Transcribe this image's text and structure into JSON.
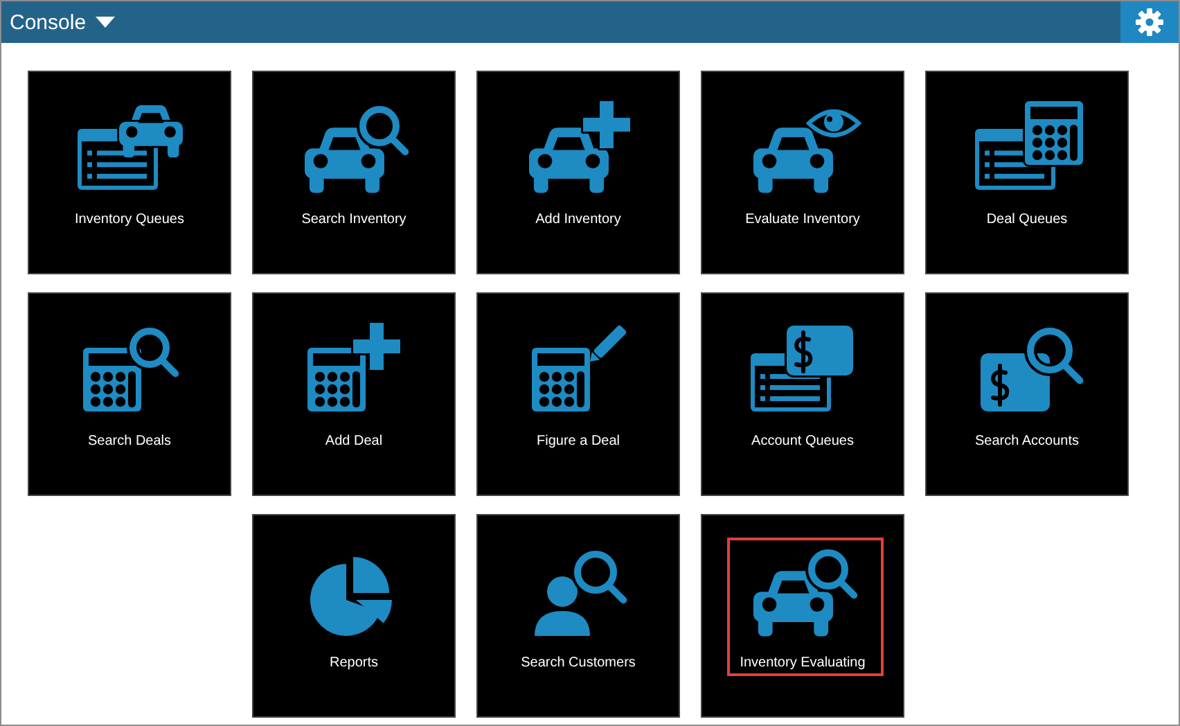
{
  "header": {
    "title": "Console"
  },
  "rows": [
    [
      {
        "label": "Inventory Queues",
        "kind": "list-car",
        "highlighted": false
      },
      {
        "label": "Search Inventory",
        "kind": "car-search",
        "highlighted": false
      },
      {
        "label": "Add Inventory",
        "kind": "car-plus",
        "highlighted": false
      },
      {
        "label": "Evaluate Inventory",
        "kind": "car-eye",
        "highlighted": false
      },
      {
        "label": "Deal Queues",
        "kind": "list-calculator",
        "highlighted": false
      }
    ],
    [
      {
        "label": "Search Deals",
        "kind": "calculator-search",
        "highlighted": false
      },
      {
        "label": "Add Deal",
        "kind": "calculator-plus",
        "highlighted": false
      },
      {
        "label": "Figure a Deal",
        "kind": "calculator-pencil",
        "highlighted": false
      },
      {
        "label": "Account Queues",
        "kind": "list-dollar",
        "highlighted": false
      },
      {
        "label": "Search Accounts",
        "kind": "dollar-search",
        "highlighted": false
      }
    ],
    [
      {
        "label": "Reports",
        "kind": "pie-chart",
        "highlighted": false
      },
      {
        "label": "Search Customers",
        "kind": "person-search",
        "highlighted": false
      },
      {
        "label": "Inventory Evaluating",
        "kind": "car-search",
        "highlighted": true
      }
    ]
  ]
}
